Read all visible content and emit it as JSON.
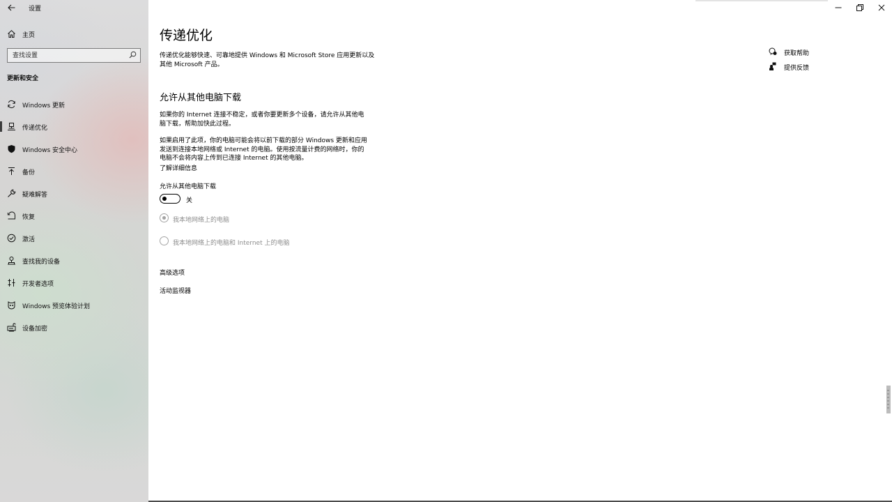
{
  "app": {
    "title": "设置"
  },
  "sidebar": {
    "home_label": "主页",
    "search_placeholder": "查找设置",
    "section_title": "更新和安全",
    "items": [
      {
        "label": "Windows 更新",
        "icon": "sync-icon",
        "selected": false
      },
      {
        "label": "传递优化",
        "icon": "delivery-optimization-icon",
        "selected": true
      },
      {
        "label": "Windows 安全中心",
        "icon": "shield-icon",
        "selected": false
      },
      {
        "label": "备份",
        "icon": "backup-icon",
        "selected": false
      },
      {
        "label": "疑难解答",
        "icon": "wrench-icon",
        "selected": false
      },
      {
        "label": "恢复",
        "icon": "recovery-icon",
        "selected": false
      },
      {
        "label": "激活",
        "icon": "activation-check-icon",
        "selected": false
      },
      {
        "label": "查找我的设备",
        "icon": "find-device-icon",
        "selected": false
      },
      {
        "label": "开发者选项",
        "icon": "developer-icon",
        "selected": false
      },
      {
        "label": "Windows 预览体验计划",
        "icon": "insider-icon",
        "selected": false
      },
      {
        "label": "设备加密",
        "icon": "encryption-icon",
        "selected": false
      }
    ]
  },
  "main": {
    "title": "传递优化",
    "description": "传递优化能够快速、可靠地提供 Windows 和 Microsoft Store 应用更新以及其他 Microsoft 产品。",
    "subheading": "允许从其他电脑下载",
    "paragraph1": "如果你的 Internet 连接不稳定，或者你要更新多个设备，请允许从其他电脑下载，帮助加快此过程。",
    "paragraph2": "如果启用了此项，你的电脑可能会将以前下载的部分 Windows 更新和应用发送到连接本地网络或 Internet 的电脑。使用按流量计费的网络时，你的电脑不会将内容上传到已连接 Internet 的其他电脑。",
    "learn_more": "了解详细信息",
    "toggle_label": "允许从其他电脑下载",
    "toggle_state": "关",
    "toggle_on": false,
    "radio_options": [
      {
        "label": "我本地网络上的电脑",
        "checked": true
      },
      {
        "label": "我本地网络上的电脑和 Internet 上的电脑",
        "checked": false
      }
    ],
    "advanced_options": "高级选项",
    "activity_monitor": "活动监视器"
  },
  "help": {
    "get_help": "获取帮助",
    "give_feedback": "提供反馈"
  }
}
